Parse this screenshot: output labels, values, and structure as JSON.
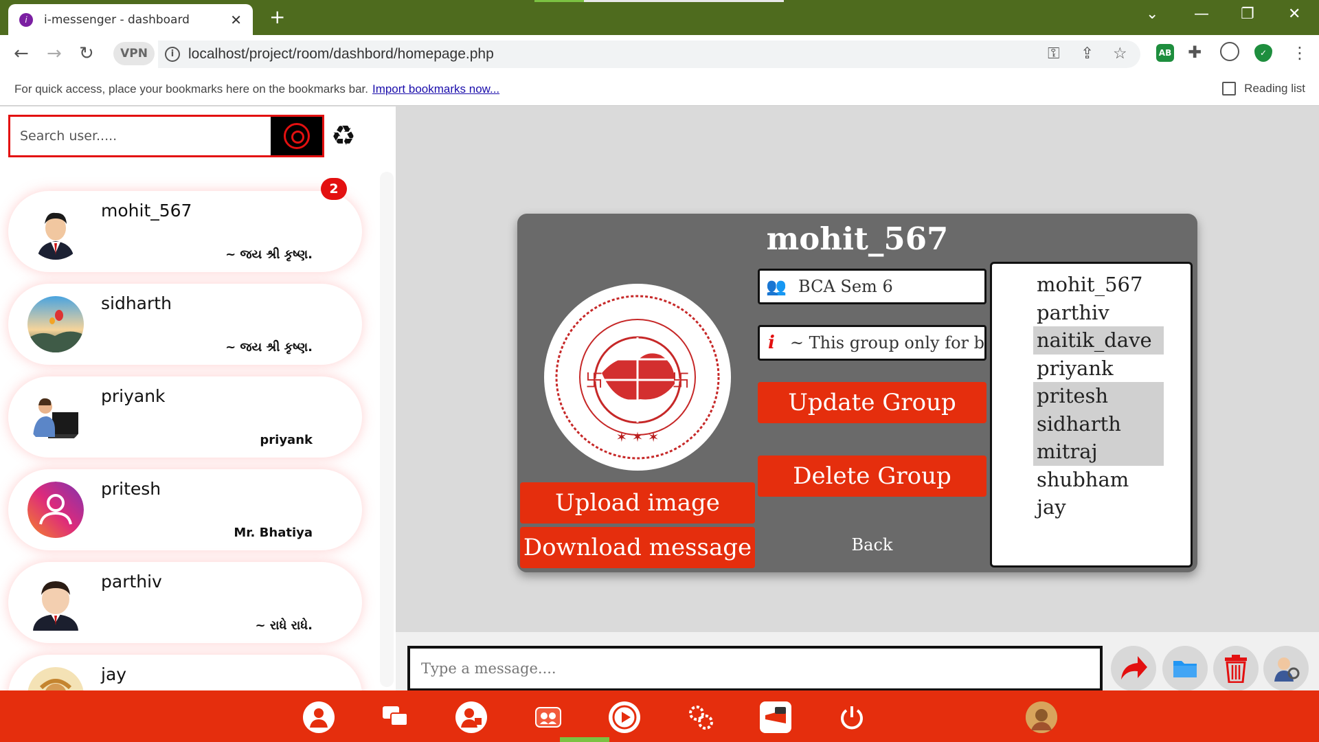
{
  "browser": {
    "tab_title": "i-messenger - dashboard",
    "url": "localhost/project/room/dashbord/homepage.php",
    "vpn_label": "VPN",
    "bookmarks_text": "For quick access, place your bookmarks here on the bookmarks bar.",
    "bookmarks_link": "Import bookmarks now...",
    "reading_list": "Reading list",
    "extensions": [
      "AB"
    ]
  },
  "sidebar": {
    "search_placeholder": "Search user.....",
    "users": [
      {
        "name": "mohit_567",
        "status": "~ જય શ્રી કૃષ્ણ.",
        "badge": "2"
      },
      {
        "name": "sidharth",
        "status": "~ જય શ્રી કૃષ્ણ."
      },
      {
        "name": "priyank",
        "status": "priyank"
      },
      {
        "name": "pritesh",
        "status": "Mr. Bhatiya"
      },
      {
        "name": "parthiv",
        "status": "~ રાધે રાધે."
      },
      {
        "name": "jay",
        "status": ""
      }
    ]
  },
  "group": {
    "title": "mohit_567",
    "group_name": "BCA Sem 6",
    "description": "~ This group only for b",
    "buttons": {
      "update": "Update Group",
      "delete": "Delete Group",
      "upload": "Upload image",
      "download": "Download message",
      "back": "Back"
    },
    "members": [
      {
        "name": "mohit_567",
        "selected": false
      },
      {
        "name": "parthiv",
        "selected": false
      },
      {
        "name": "naitik_dave",
        "selected": true
      },
      {
        "name": "priyank",
        "selected": false
      },
      {
        "name": "pritesh",
        "selected": true
      },
      {
        "name": "sidharth",
        "selected": true
      },
      {
        "name": "mitraj",
        "selected": true
      },
      {
        "name": "shubham",
        "selected": false
      },
      {
        "name": "jay",
        "selected": false
      }
    ]
  },
  "composer": {
    "placeholder": "Type a message...."
  },
  "colors": {
    "accent_red": "#e52e0d",
    "chrome_green": "#4e6b1e",
    "modal_gray": "#6a6a6a"
  }
}
